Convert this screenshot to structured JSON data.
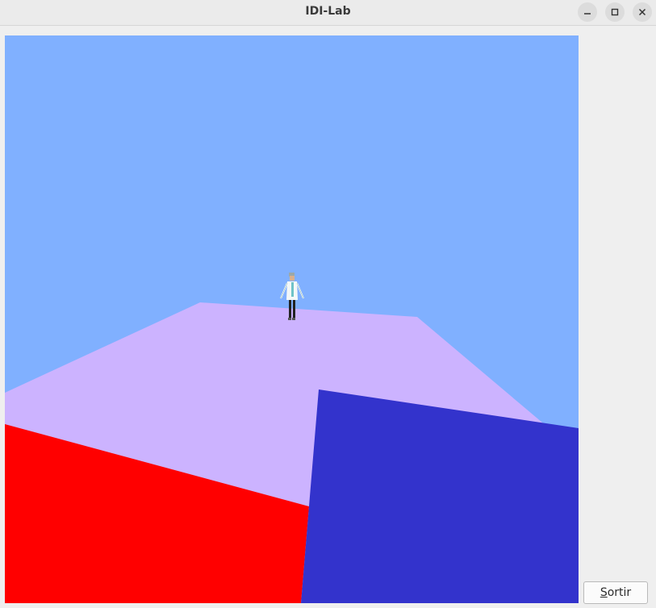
{
  "window": {
    "title": "IDI-Lab"
  },
  "titlebar_buttons": {
    "minimize": "minimize-icon",
    "maximize": "maximize-icon",
    "close": "close-icon"
  },
  "scene": {
    "colors": {
      "sky": "#80b0ff",
      "floor": "#ccb3ff",
      "red_block": "#ff0000",
      "blue_block": "#3333cc"
    },
    "character": "patricio-figure"
  },
  "actions": {
    "quit_mnemonic": "S",
    "quit_rest": "ortir"
  }
}
